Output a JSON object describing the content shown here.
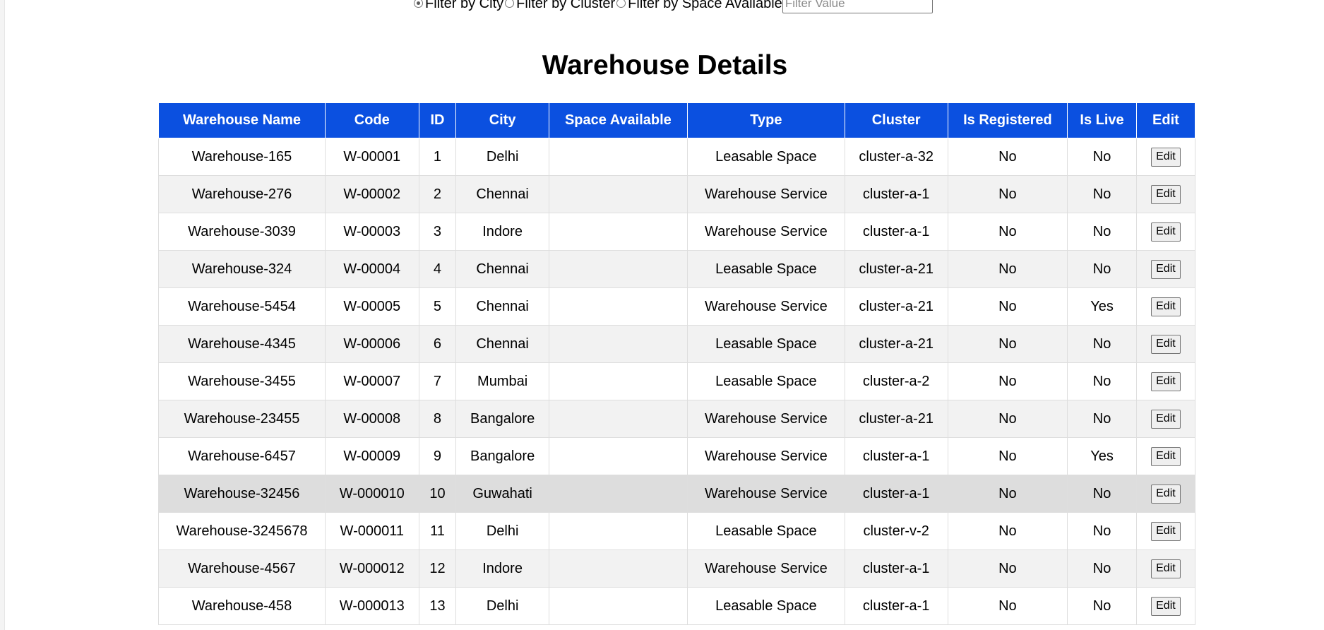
{
  "filters": {
    "options": [
      {
        "label": "Filter by City",
        "checked": true
      },
      {
        "label": "Filter by Cluster",
        "checked": false
      },
      {
        "label": "Filter by Space Available",
        "checked": false
      }
    ],
    "input_placeholder": "Filter Value",
    "input_value": ""
  },
  "page_title": "Warehouse Details",
  "table": {
    "columns": [
      "Warehouse Name",
      "Code",
      "ID",
      "City",
      "Space Available",
      "Type",
      "Cluster",
      "Is Registered",
      "Is Live",
      "Edit"
    ],
    "edit_label": "Edit",
    "rows": [
      {
        "name": "Warehouse-165",
        "code": "W-00001",
        "id": "1",
        "city": "Delhi",
        "space": "",
        "type": "Leasable Space",
        "cluster": "cluster-a-32",
        "registered": "No",
        "live": "No"
      },
      {
        "name": "Warehouse-276",
        "code": "W-00002",
        "id": "2",
        "city": "Chennai",
        "space": "",
        "type": "Warehouse Service",
        "cluster": "cluster-a-1",
        "registered": "No",
        "live": "No"
      },
      {
        "name": "Warehouse-3039",
        "code": "W-00003",
        "id": "3",
        "city": "Indore",
        "space": "",
        "type": "Warehouse Service",
        "cluster": "cluster-a-1",
        "registered": "No",
        "live": "No"
      },
      {
        "name": "Warehouse-324",
        "code": "W-00004",
        "id": "4",
        "city": "Chennai",
        "space": "",
        "type": "Leasable Space",
        "cluster": "cluster-a-21",
        "registered": "No",
        "live": "No"
      },
      {
        "name": "Warehouse-5454",
        "code": "W-00005",
        "id": "5",
        "city": "Chennai",
        "space": "",
        "type": "Warehouse Service",
        "cluster": "cluster-a-21",
        "registered": "No",
        "live": "Yes"
      },
      {
        "name": "Warehouse-4345",
        "code": "W-00006",
        "id": "6",
        "city": "Chennai",
        "space": "",
        "type": "Leasable Space",
        "cluster": "cluster-a-21",
        "registered": "No",
        "live": "No"
      },
      {
        "name": "Warehouse-3455",
        "code": "W-00007",
        "id": "7",
        "city": "Mumbai",
        "space": "",
        "type": "Leasable Space",
        "cluster": "cluster-a-2",
        "registered": "No",
        "live": "No"
      },
      {
        "name": "Warehouse-23455",
        "code": "W-00008",
        "id": "8",
        "city": "Bangalore",
        "space": "",
        "type": "Warehouse Service",
        "cluster": "cluster-a-21",
        "registered": "No",
        "live": "No"
      },
      {
        "name": "Warehouse-6457",
        "code": "W-00009",
        "id": "9",
        "city": "Bangalore",
        "space": "",
        "type": "Warehouse Service",
        "cluster": "cluster-a-1",
        "registered": "No",
        "live": "Yes"
      },
      {
        "name": "Warehouse-32456",
        "code": "W-000010",
        "id": "10",
        "city": "Guwahati",
        "space": "",
        "type": "Warehouse Service",
        "cluster": "cluster-a-1",
        "registered": "No",
        "live": "No",
        "hovered": true
      },
      {
        "name": "Warehouse-3245678",
        "code": "W-000011",
        "id": "11",
        "city": "Delhi",
        "space": "",
        "type": "Leasable Space",
        "cluster": "cluster-v-2",
        "registered": "No",
        "live": "No"
      },
      {
        "name": "Warehouse-4567",
        "code": "W-000012",
        "id": "12",
        "city": "Indore",
        "space": "",
        "type": "Warehouse Service",
        "cluster": "cluster-a-1",
        "registered": "No",
        "live": "No"
      },
      {
        "name": "Warehouse-458",
        "code": "W-000013",
        "id": "13",
        "city": "Delhi",
        "space": "",
        "type": "Leasable Space",
        "cluster": "cluster-a-1",
        "registered": "No",
        "live": "No"
      }
    ]
  }
}
